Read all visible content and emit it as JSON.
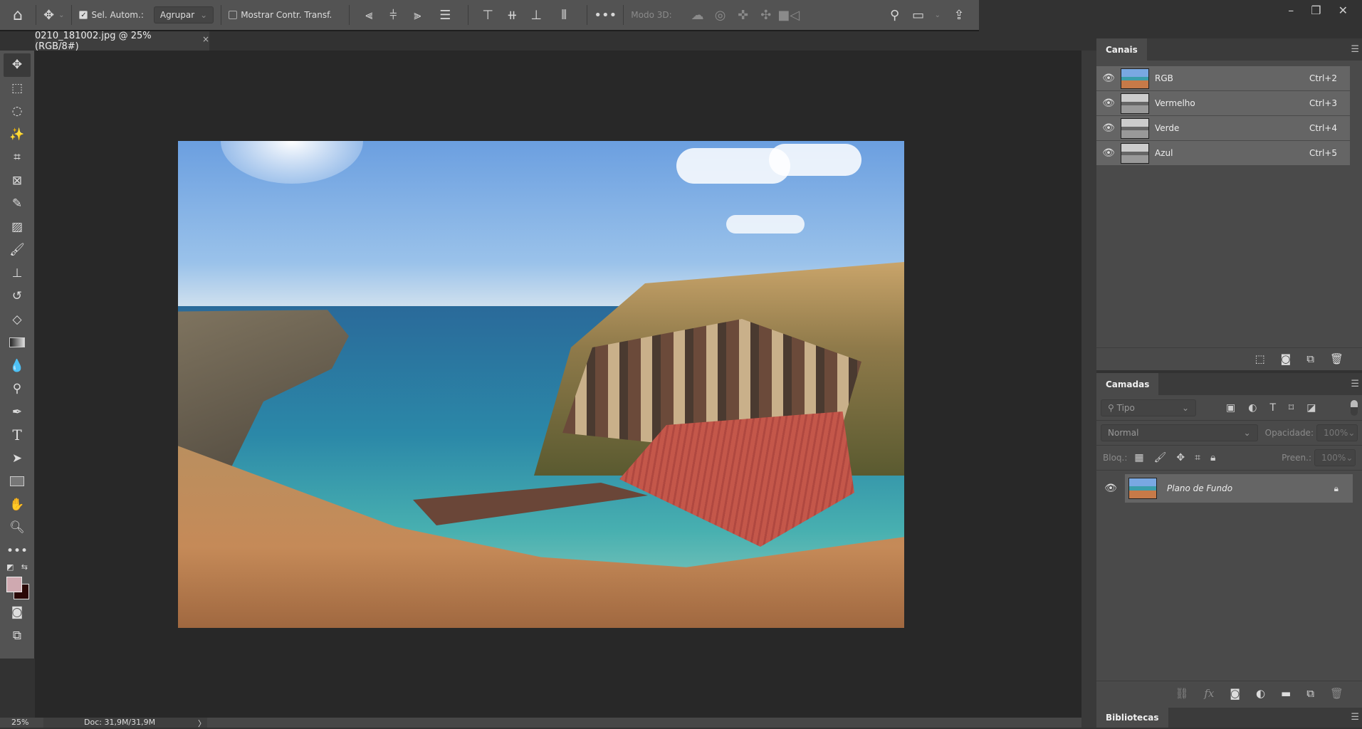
{
  "options_bar": {
    "home_icon": "home-icon",
    "move_icon": "move-icon",
    "auto_select_label": "Sel. Autom.:",
    "auto_select_checked": true,
    "auto_select_value": "Agrupar",
    "show_transform_label": "Mostrar Contr. Transf.",
    "show_transform_checked": false,
    "more_icon": "more-icon",
    "mode3d_label": "Modo 3D:"
  },
  "document_tab": {
    "title": "0210_181002.jpg @ 25% (RGB/8#)",
    "close": "×"
  },
  "tools": [
    "move",
    "marquee",
    "lasso",
    "magic-wand",
    "crop",
    "frame",
    "eyedropper",
    "healing",
    "brush",
    "stamp",
    "history-brush",
    "eraser",
    "gradient",
    "blur",
    "dodge",
    "pen",
    "type",
    "path-select",
    "rectangle",
    "hand",
    "zoom",
    "more"
  ],
  "colors": {
    "foreground": "#cfa9b0",
    "background": "#2a0806",
    "accent": "#656565"
  },
  "status": {
    "zoom": "25%",
    "doc": "Doc: 31,9M/31,9M",
    "arrow": "〉"
  },
  "channels": {
    "tab": "Canais",
    "rows": [
      {
        "name": "RGB",
        "shortcut": "Ctrl+2"
      },
      {
        "name": "Vermelho",
        "shortcut": "Ctrl+3"
      },
      {
        "name": "Verde",
        "shortcut": "Ctrl+4"
      },
      {
        "name": "Azul",
        "shortcut": "Ctrl+5"
      }
    ]
  },
  "layers": {
    "tab": "Camadas",
    "filter_placeholder": "Tipo",
    "blend_mode": "Normal",
    "opacity_label": "Opacidade:",
    "opacity_value": "100%",
    "lock_label": "Bloq.:",
    "fill_label": "Preen.:",
    "fill_value": "100%",
    "layer_name": "Plano de Fundo"
  },
  "libraries": {
    "tab": "Bibliotecas"
  }
}
